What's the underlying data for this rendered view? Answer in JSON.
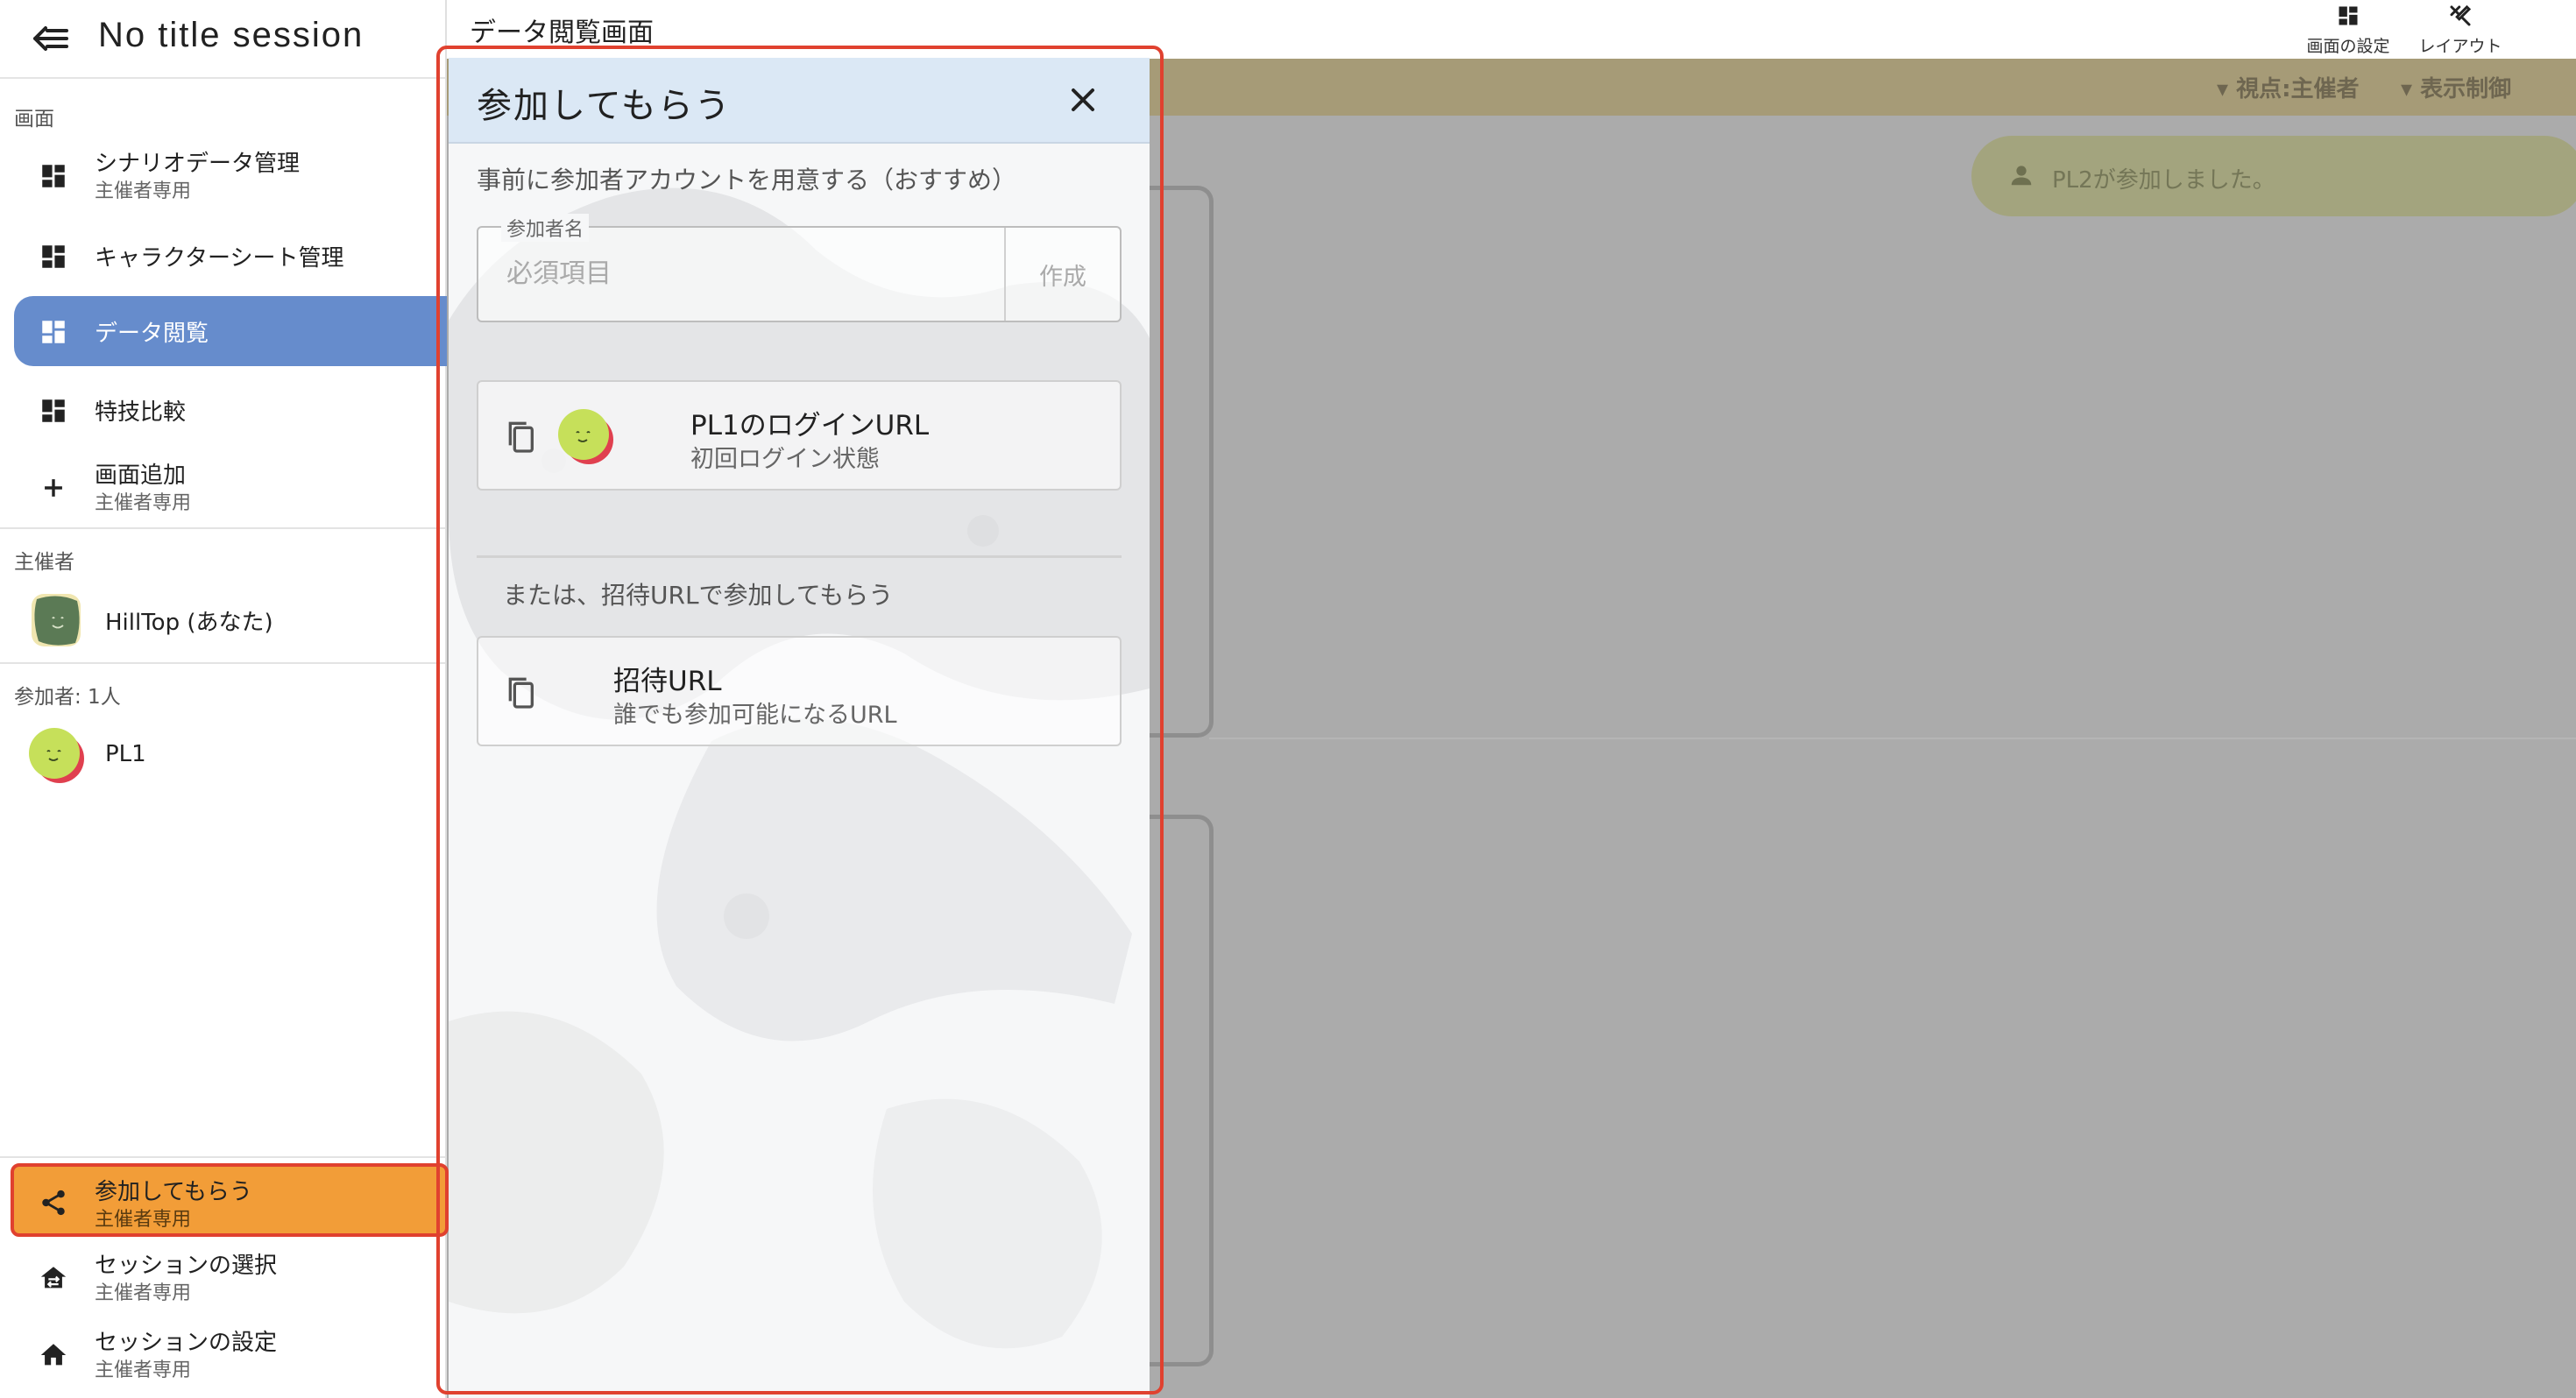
{
  "sidebar": {
    "session_title": "No title session",
    "section_screens": "画面",
    "screens": [
      {
        "label": "シナリオデータ管理",
        "sub": "主催者専用",
        "icon": "dashboard-icon"
      },
      {
        "label": "キャラクターシート管理",
        "sub": "",
        "icon": "dashboard-icon"
      },
      {
        "label": "データ閲覧",
        "sub": "",
        "icon": "dashboard-icon",
        "active": true
      },
      {
        "label": "特技比較",
        "sub": "",
        "icon": "dashboard-icon"
      },
      {
        "label": "画面追加",
        "sub": "主催者専用",
        "icon": "plus-icon"
      }
    ],
    "section_host": "主催者",
    "host": {
      "name": "HillTop (あなた)"
    },
    "section_participants": "参加者: 1人",
    "participants": [
      {
        "name": "PL1"
      }
    ],
    "footer": [
      {
        "label": "参加してもらう",
        "sub": "主催者専用",
        "icon": "share-icon"
      },
      {
        "label": "セッションの選択",
        "sub": "主催者専用",
        "icon": "house-swap-icon"
      },
      {
        "label": "セッションの設定",
        "sub": "主催者専用",
        "icon": "home-icon"
      }
    ]
  },
  "topbar": {
    "screen_title": "データ閲覧画面",
    "screen_settings_label": "画面の設定",
    "layout_label": "レイアウト"
  },
  "subbar": {
    "viewpoint": "▾ 視点:主催者",
    "display_control": "▾ 表示制御"
  },
  "toast": {
    "text": "PL2が参加しました。"
  },
  "dialog": {
    "title": "参加してもらう",
    "recommend": "事前に参加者アカウントを用意する（おすすめ）",
    "name_label": "参加者名",
    "name_placeholder": "必須項目",
    "create_label": "作成",
    "login_card": {
      "title": "PL1のログインURL",
      "subtitle": "初回ログイン状態"
    },
    "or_text": "または、招待URLで参加してもらう",
    "invite_card": {
      "title": "招待URL",
      "subtitle": "誰でも参加可能になるURL"
    }
  },
  "colors": {
    "active_nav": "#668ccc",
    "invite_nav": "#f29d38",
    "highlight": "#e0412f",
    "dialog_header": "#dbe8f5",
    "pl1_avatar": "#c6e05a",
    "pl1_avatar_accent": "#e0404f",
    "host_avatar": "#5b7a55"
  }
}
